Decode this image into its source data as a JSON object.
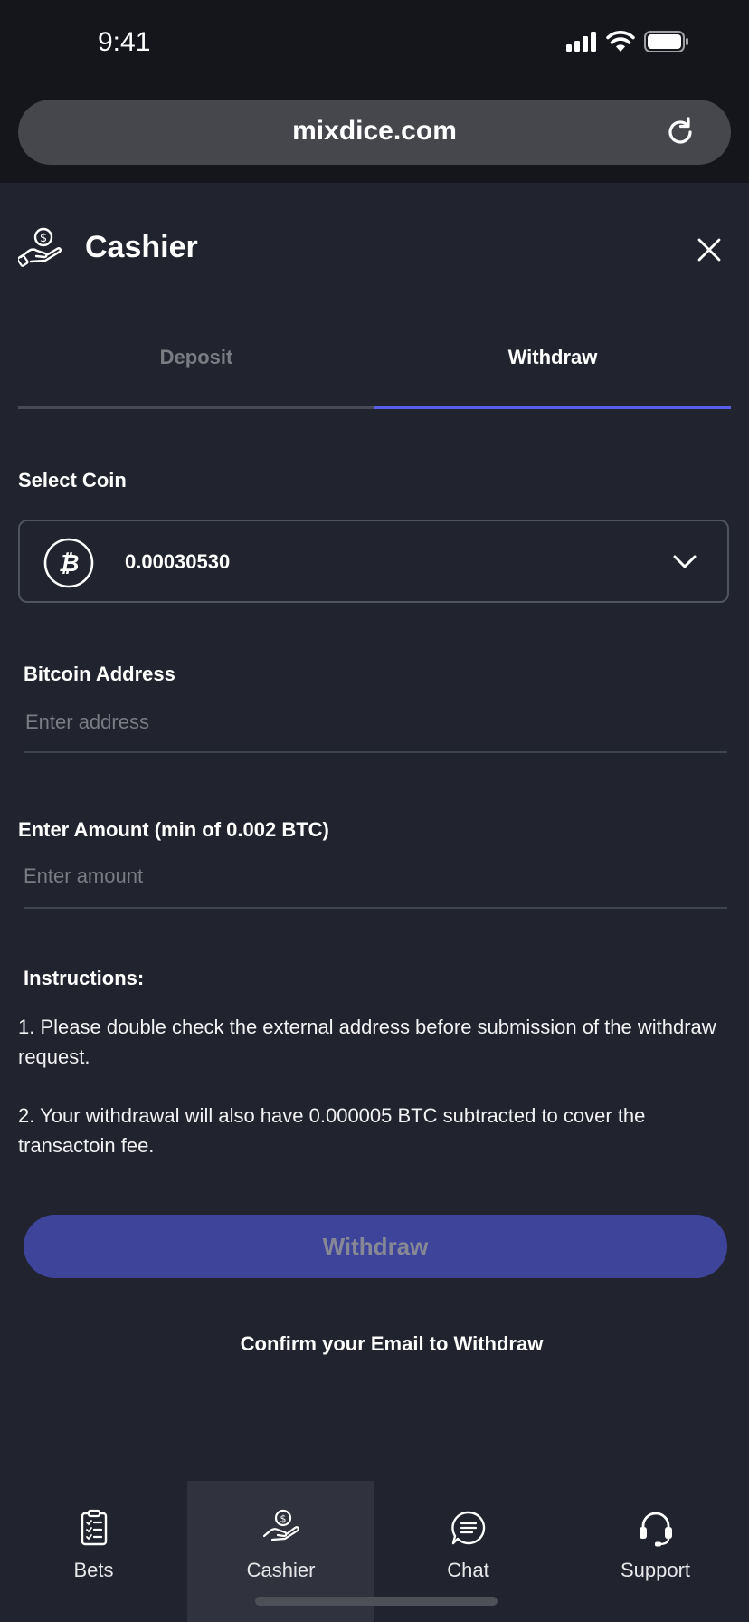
{
  "status_bar": {
    "time": "9:41"
  },
  "browser": {
    "url": "mixdice.com"
  },
  "header": {
    "title": "Cashier"
  },
  "tabs": [
    {
      "label": "Deposit",
      "active": false
    },
    {
      "label": "Withdraw",
      "active": true
    }
  ],
  "select_coin": {
    "label": "Select Coin",
    "value": "0.00030530",
    "coin_icon": "bitcoin-icon"
  },
  "address": {
    "label": "Bitcoin Address",
    "placeholder": "Enter address"
  },
  "amount": {
    "label": "Enter Amount (min of 0.002 BTC)",
    "placeholder": "Enter amount"
  },
  "instructions": {
    "label": "Instructions:",
    "items": [
      "1. Please double check the external address before submission of the withdraw request.",
      "2. Your withdrawal will also have 0.000005 BTC subtracted to cover the transactoin fee."
    ]
  },
  "withdraw_button": {
    "label": "Withdraw"
  },
  "confirm_message": "Confirm your Email to Withdraw",
  "bottom_nav": [
    {
      "label": "Bets",
      "icon": "clipboard-list-icon",
      "active": false
    },
    {
      "label": "Cashier",
      "icon": "hand-coin-icon",
      "active": true
    },
    {
      "label": "Chat",
      "icon": "chat-bubble-icon",
      "active": false
    },
    {
      "label": "Support",
      "icon": "headset-icon",
      "active": false
    }
  ],
  "colors": {
    "background": "#21232f",
    "accent": "#5b5ee8",
    "button": "#3d4499",
    "nav_active": "#30323e"
  }
}
